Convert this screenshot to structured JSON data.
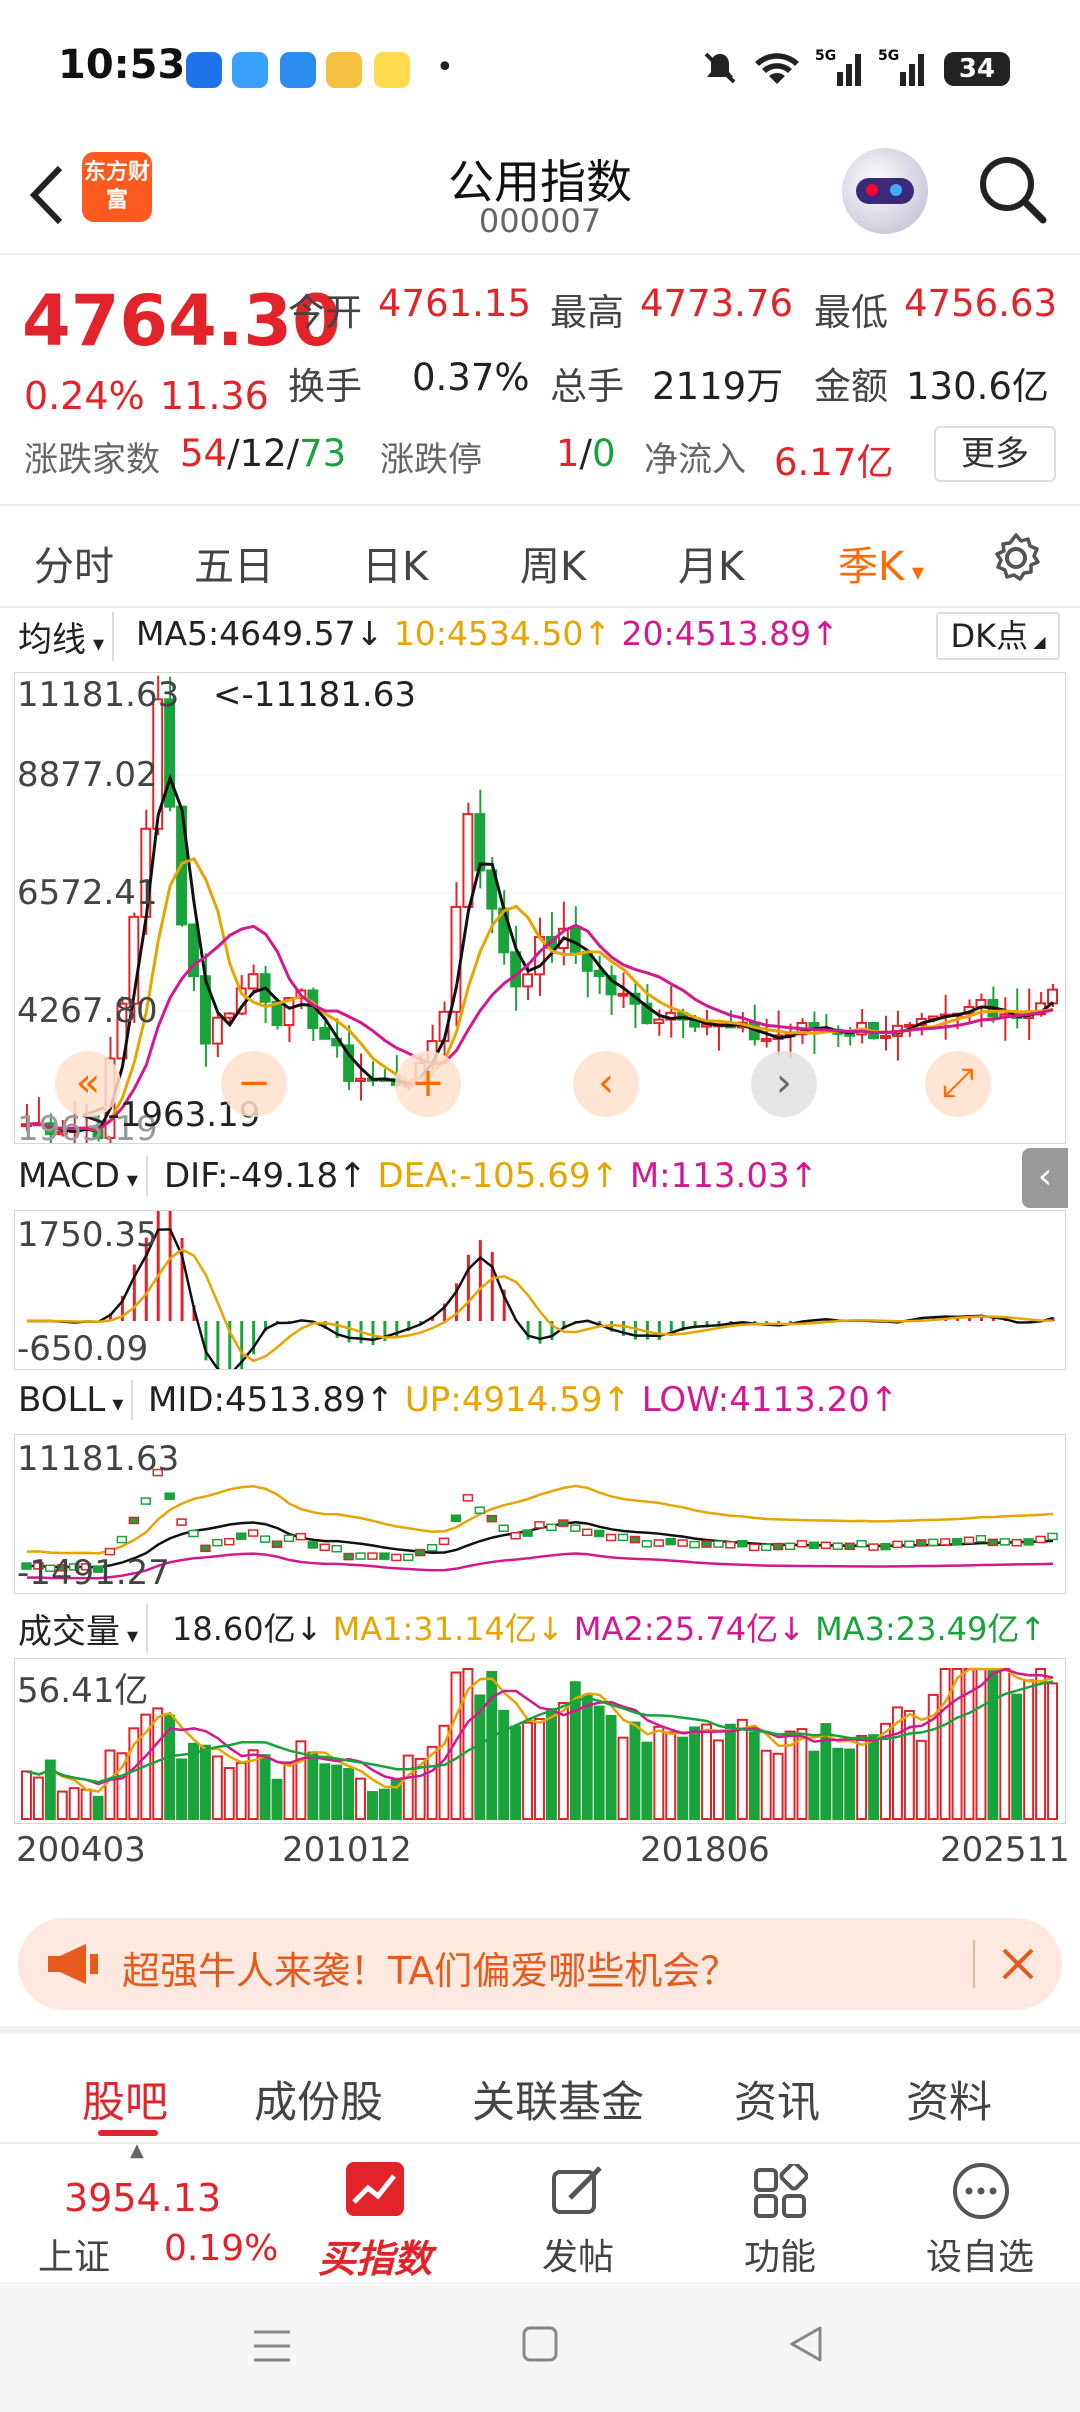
{
  "status_bar": {
    "time": "10:53",
    "battery": "34"
  },
  "header": {
    "title": "公用指数",
    "code": "000007",
    "logo_text": "东方财富"
  },
  "quote": {
    "price": "4764.30",
    "change_pct": "0.24%",
    "change": "11.36",
    "open_label": "今开",
    "open": "4761.15",
    "high_label": "最高",
    "high": "4773.76",
    "low_label": "最低",
    "low": "4756.63",
    "turnover_label": "换手",
    "turnover": "0.37%",
    "volume_label": "总手",
    "volume": "2119万",
    "amount_label": "金额",
    "amount": "130.6亿",
    "breadth_label": "涨跌家数",
    "up": "54",
    "flat": "12",
    "down": "73",
    "limit_label": "涨跌停",
    "limit_up": "1",
    "limit_down": "0",
    "inflow_label": "净流入",
    "inflow": "6.17亿",
    "more": "更多"
  },
  "tabs": [
    "分时",
    "五日",
    "日K",
    "周K",
    "月K",
    "季K"
  ],
  "tab_active": "季K",
  "ma": {
    "selector": "均线",
    "ma5": "MA5:4649.57",
    "ma5_arrow": "↓",
    "ma10": "10:4534.50",
    "ma10_arrow": "↑",
    "ma20": "20:4513.89",
    "ma20_arrow": "↑",
    "dk": "DK点"
  },
  "main_axis": {
    "t1": "11181.63",
    "t2": "8877.02",
    "t3": "6572.41",
    "t4": "4267.80",
    "t5": "1963.19",
    "max_label": "<-11181.63",
    "min_label": "<-1963.19"
  },
  "macd": {
    "selector": "MACD",
    "dif": "DIF:-49.18",
    "dif_arrow": "↑",
    "dea": "DEA:-105.69",
    "dea_arrow": "↑",
    "m": "M:113.03",
    "m_arrow": "↑",
    "top": "1750.35",
    "bottom": "-650.09"
  },
  "boll": {
    "selector": "BOLL",
    "mid": "MID:4513.89",
    "mid_arrow": "↑",
    "up": "UP:4914.59",
    "up_arrow": "↑",
    "low": "LOW:4113.20",
    "low_arrow": "↑",
    "top": "11181.63",
    "bottom": "-1491.27"
  },
  "vol": {
    "selector": "成交量",
    "v": "18.60亿",
    "v_arrow": "↓",
    "ma1": "MA1:31.14亿",
    "ma1_arrow": "↓",
    "ma2": "MA2:25.74亿",
    "ma2_arrow": "↓",
    "ma3": "MA3:23.49亿",
    "ma3_arrow": "↑",
    "top": "56.41亿"
  },
  "dates": [
    "200403",
    "201012",
    "201806",
    "202511"
  ],
  "banner": {
    "text": "超强牛人来袭！TA们偏爱哪些机会？"
  },
  "bottom_tabs": [
    "股吧",
    "成份股",
    "关联基金",
    "资讯",
    "资料"
  ],
  "bottom_bar": {
    "index_value": "3954.13",
    "index_name": "上证",
    "index_pct": "0.19%",
    "buy": "买指数",
    "post": "发帖",
    "func": "功能",
    "watch": "设自选"
  },
  "colors": {
    "up": "#e2232a",
    "down": "#18a33b",
    "accent": "#ff6a00",
    "ma5": "#111111",
    "ma10": "#e8a400",
    "ma20": "#d4188f"
  }
}
